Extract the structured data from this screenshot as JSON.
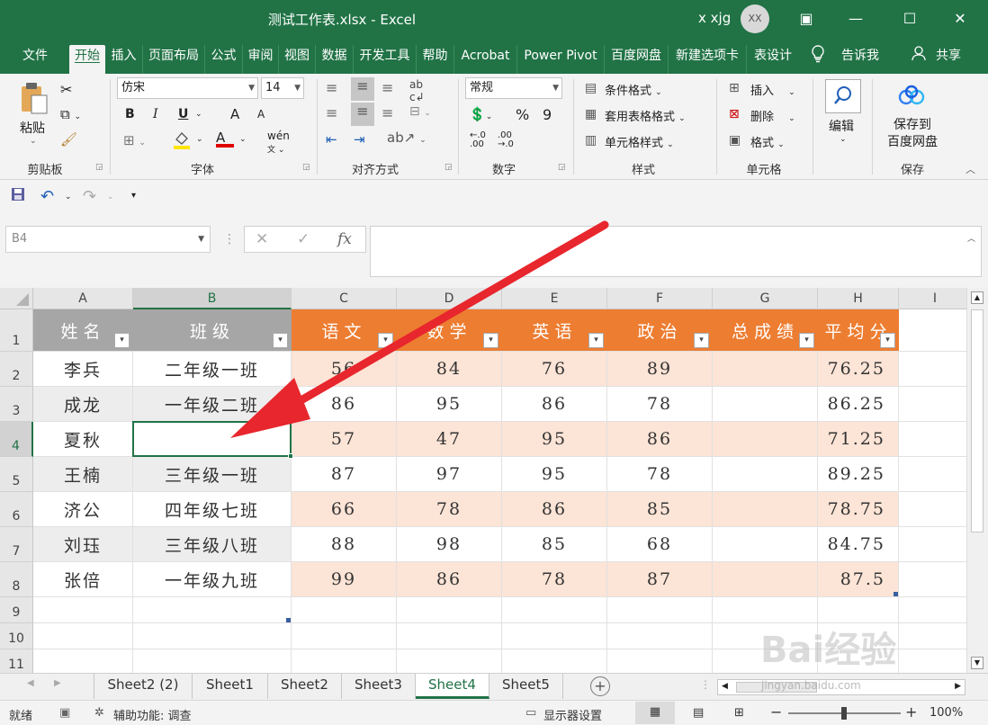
{
  "window": {
    "title": "测试工作表.xlsx  -  Excel",
    "user": "x xjg",
    "avatar_initials": "XX",
    "minimize": "—",
    "restore": "▣",
    "maximize": "☐",
    "close": "✕"
  },
  "ribbon_tabs": [
    "文件",
    "开始",
    "插入",
    "页面布局",
    "公式",
    "审阅",
    "视图",
    "数据",
    "开发工具",
    "帮助",
    "Acrobat",
    "Power Pivot",
    "百度网盘",
    "新建选项卡",
    "表设计"
  ],
  "ribbon_extra": {
    "tell_me": "告诉我",
    "share": "共享"
  },
  "ribbon": {
    "clipboard": {
      "paste": "粘贴",
      "label": "剪贴板"
    },
    "font": {
      "name": "仿宋",
      "size": "14",
      "bold": "B",
      "italic": "I",
      "underline": "U",
      "grow": "A",
      "shrink": "A",
      "color_a": "A",
      "label": "字体"
    },
    "alignment": {
      "label": "对齐方式"
    },
    "number": {
      "format": "常规",
      "percent": "%",
      "comma": "9",
      "label": "数字"
    },
    "styles": {
      "conditional": "条件格式",
      "table": "套用表格格式",
      "cell_styles": "单元格样式",
      "label": "样式"
    },
    "cells": {
      "insert": "插入",
      "delete": "删除",
      "format": "格式",
      "label": "单元格"
    },
    "editing": {
      "label": "编辑"
    },
    "save": {
      "btn": "保存到\n百度网盘",
      "line1": "保存到",
      "line2": "百度网盘",
      "label": "保存"
    }
  },
  "formula_bar": {
    "name_box": "B4",
    "fx": "fx",
    "cancel": "✕",
    "enter": "✓"
  },
  "columns": [
    "A",
    "B",
    "C",
    "D",
    "E",
    "F",
    "G",
    "H",
    "I"
  ],
  "rows": [
    "1",
    "2",
    "3",
    "4",
    "5",
    "6",
    "7",
    "8",
    "9",
    "10",
    "11"
  ],
  "table": {
    "headers": [
      "姓名",
      "班级",
      "语文",
      "数学",
      "英语",
      "政治",
      "总成绩",
      "平均分"
    ],
    "rows": [
      [
        "李兵",
        "二年级一班",
        "56",
        "84",
        "76",
        "89",
        "",
        "76.25"
      ],
      [
        "成龙",
        "一年级二班",
        "86",
        "95",
        "86",
        "78",
        "",
        "86.25"
      ],
      [
        "夏秋",
        "",
        "57",
        "47",
        "95",
        "86",
        "",
        "71.25"
      ],
      [
        "王楠",
        "三年级一班",
        "87",
        "97",
        "95",
        "78",
        "",
        "89.25"
      ],
      [
        "济公",
        "四年级七班",
        "66",
        "78",
        "86",
        "85",
        "",
        "78.75"
      ],
      [
        "刘珏",
        "三年级八班",
        "88",
        "98",
        "85",
        "68",
        "",
        "84.75"
      ],
      [
        "张倍",
        "一年级九班",
        "99",
        "86",
        "78",
        "87",
        "",
        "87.5"
      ]
    ]
  },
  "sheets": [
    "Sheet2 (2)",
    "Sheet1",
    "Sheet2",
    "Sheet3",
    "Sheet4",
    "Sheet5"
  ],
  "active_sheet": "Sheet4",
  "status": {
    "ready": "就绪",
    "accessibility": "辅助功能: 调查",
    "display": "显示器设置",
    "zoom": "100%"
  },
  "watermark": {
    "logo": "Bai经验",
    "url": "jingyan.baidu.com"
  },
  "colors": {
    "excel_green": "#217346",
    "header_orange": "#ed7d31",
    "band_orange": "#fce4d6",
    "arrow_red": "#e8262d"
  }
}
